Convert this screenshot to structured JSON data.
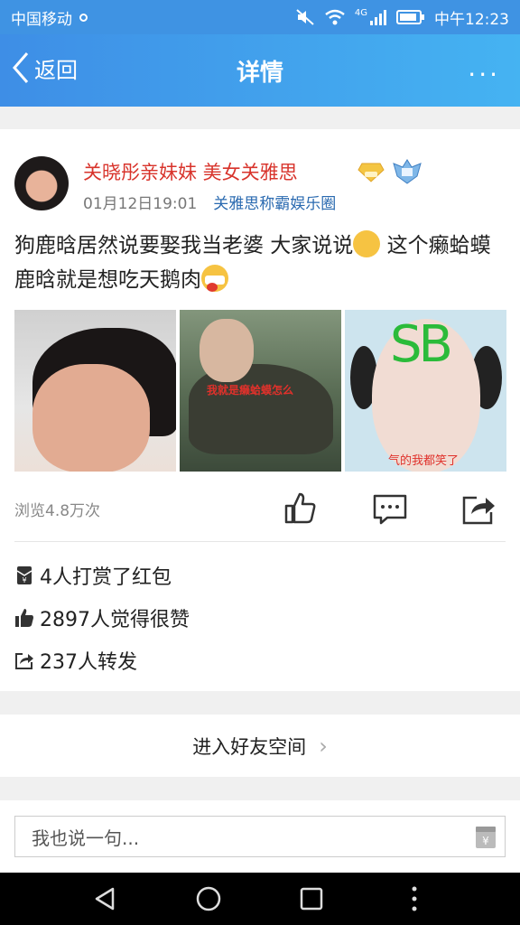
{
  "status_bar": {
    "carrier": "中国移动",
    "network": "4G",
    "time": "中午12:23"
  },
  "header": {
    "back_label": "返回",
    "title": "详情",
    "more_label": "···"
  },
  "post": {
    "author": "关晓彤亲妹妹 美女关雅思",
    "time": "01月12日19:01",
    "circle": "关雅思称霸娱乐圈",
    "text_part1": "狗鹿晗居然说要娶我当老婆 大家说说",
    "text_part2": " 这个癞蛤蟆鹿晗就是想吃天鹅肉",
    "images": [
      {
        "caption": ""
      },
      {
        "caption": "我就是癞蛤蟆怎么"
      },
      {
        "caption": "气的我都笑了",
        "overlay": "SB"
      }
    ],
    "views": "浏览4.8万次"
  },
  "stats": {
    "rewards": "4人打赏了红包",
    "likes": "2897人觉得很赞",
    "shares": "237人转发"
  },
  "enter_space": {
    "label": "进入好友空间",
    "chevron": "›"
  },
  "comment": {
    "placeholder": "我也说一句..."
  },
  "colors": {
    "header": "#3e8ee6",
    "author": "#d8332b",
    "circle": "#2a6ab0"
  },
  "icons": {
    "back": "chevron-left-icon",
    "like": "thumbs-up-icon",
    "comment": "comment-icon",
    "share": "share-icon",
    "reward": "red-envelope-icon",
    "gift": "gift-icon"
  }
}
